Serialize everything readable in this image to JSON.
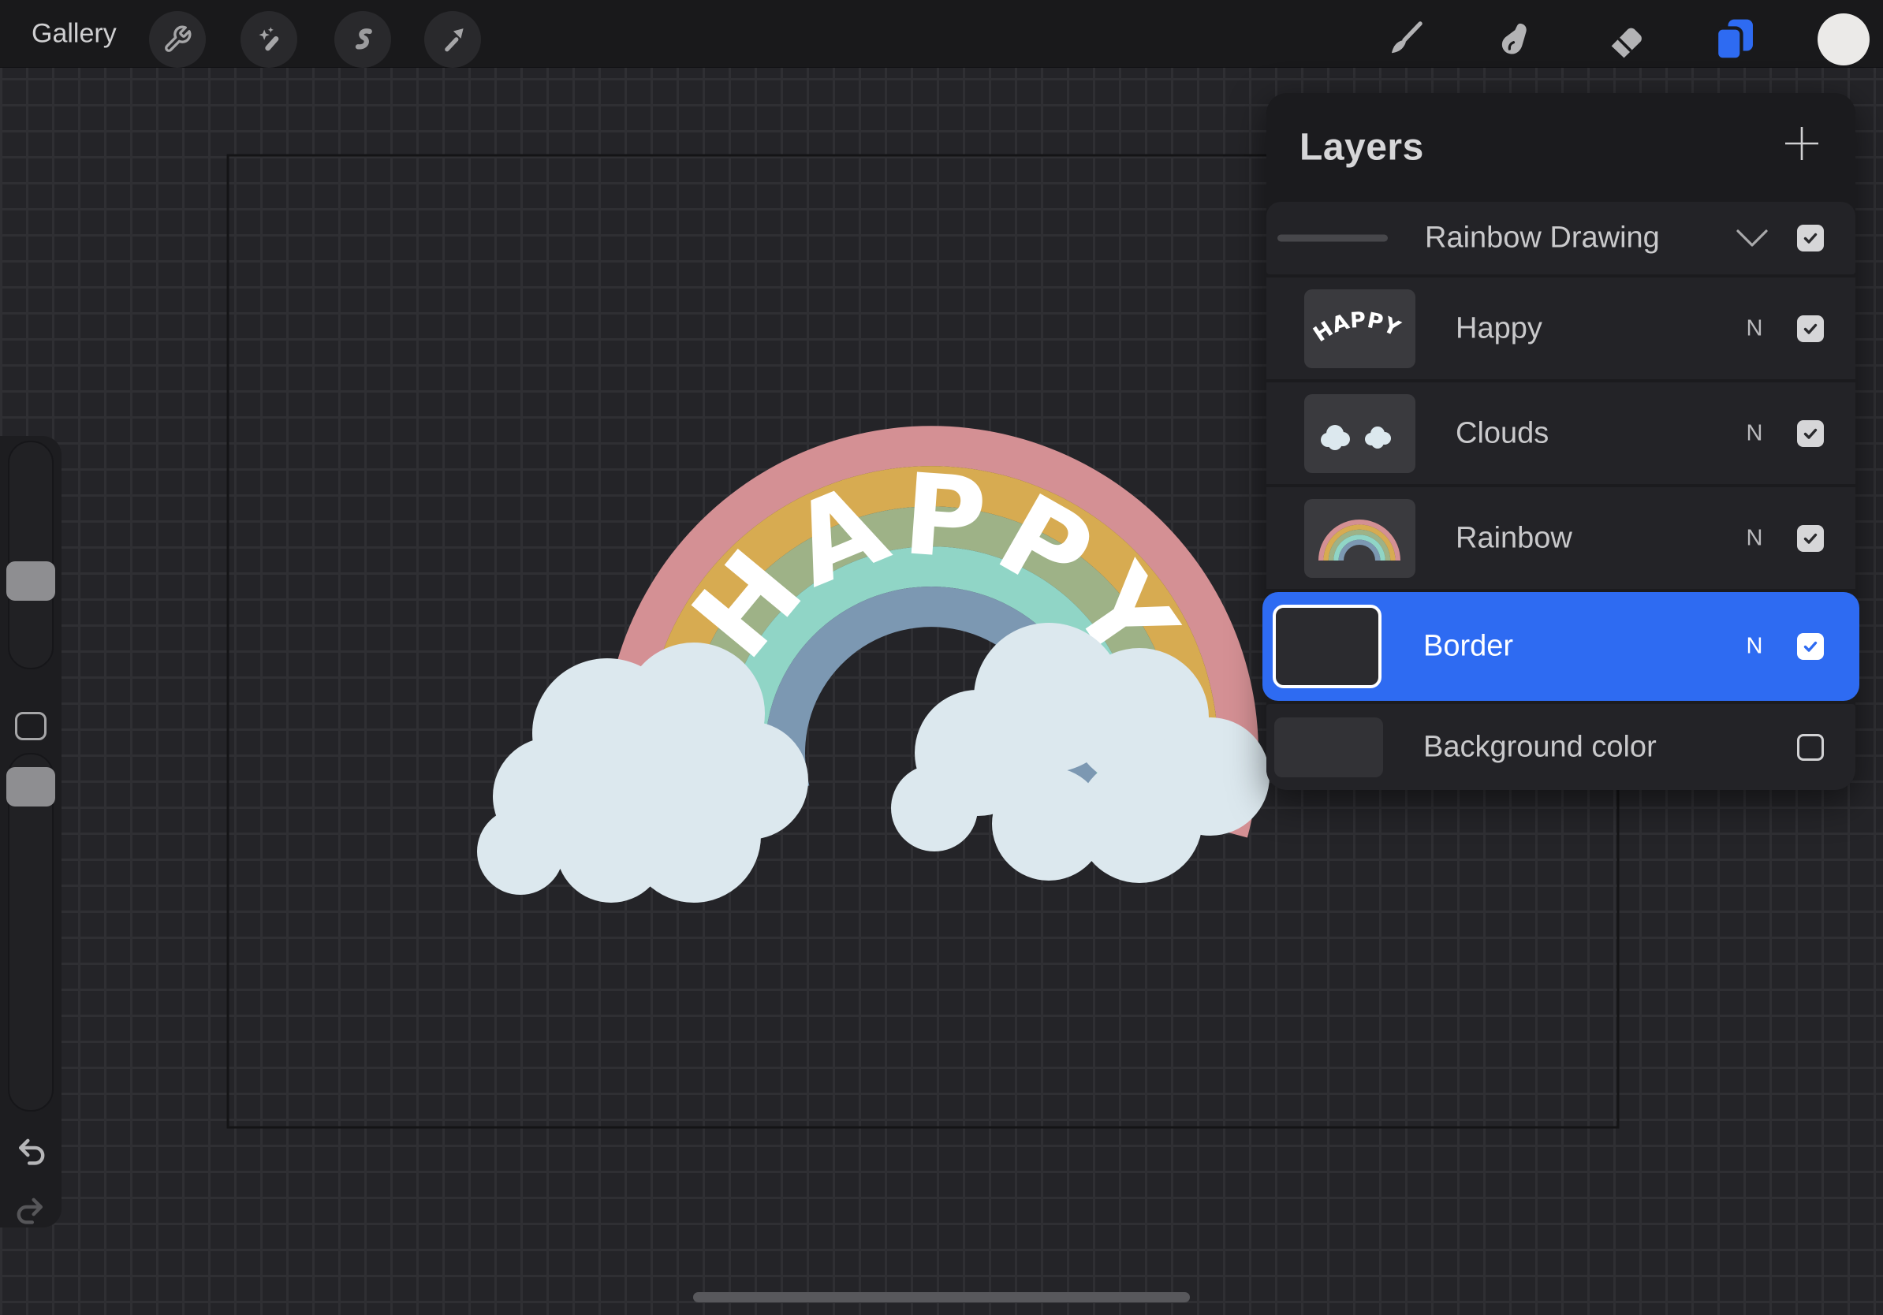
{
  "toolbar": {
    "gallery_label": "Gallery",
    "left_tools": [
      {
        "label": "Actions",
        "icon": "wrench-icon"
      },
      {
        "label": "Adjustments",
        "icon": "magic-wand-icon"
      },
      {
        "label": "Selection",
        "icon": "selection-s-icon"
      },
      {
        "label": "Transform",
        "icon": "transform-arrow-icon"
      }
    ],
    "right_tools": [
      {
        "label": "Paint",
        "icon": "brush-icon"
      },
      {
        "label": "Smudge",
        "icon": "smudge-finger-icon"
      },
      {
        "label": "Erase",
        "icon": "eraser-icon"
      },
      {
        "label": "Layers",
        "icon": "layers-icon",
        "active": true
      },
      {
        "label": "Color",
        "icon": "color-circle-icon"
      }
    ],
    "active_tool": "Layers"
  },
  "layers_panel": {
    "title": "Layers",
    "rows": [
      {
        "name": "Rainbow Drawing",
        "type": "group",
        "visible": true,
        "expanded": true
      },
      {
        "name": "Happy",
        "type": "layer",
        "blend": "N",
        "visible": true
      },
      {
        "name": "Clouds",
        "type": "layer",
        "blend": "N",
        "visible": true
      },
      {
        "name": "Rainbow",
        "type": "layer",
        "blend": "N",
        "visible": true
      },
      {
        "name": "Border",
        "type": "layer",
        "blend": "N",
        "visible": true,
        "selected": true
      },
      {
        "name": "Background color",
        "type": "background",
        "visible": false
      }
    ],
    "selected_layer": "Border"
  },
  "artwork": {
    "happy_text": "HAPPY"
  },
  "colors": {
    "accent_blue": "#2e6bf2",
    "rainbow_pink": "#d49094",
    "rainbow_yellow": "#d7ab51",
    "rainbow_green": "#9eb287",
    "rainbow_teal": "#90d5c6",
    "rainbow_blue": "#7c98b2",
    "cloud": "#dce8ee",
    "happy_white": "#ffffff"
  }
}
